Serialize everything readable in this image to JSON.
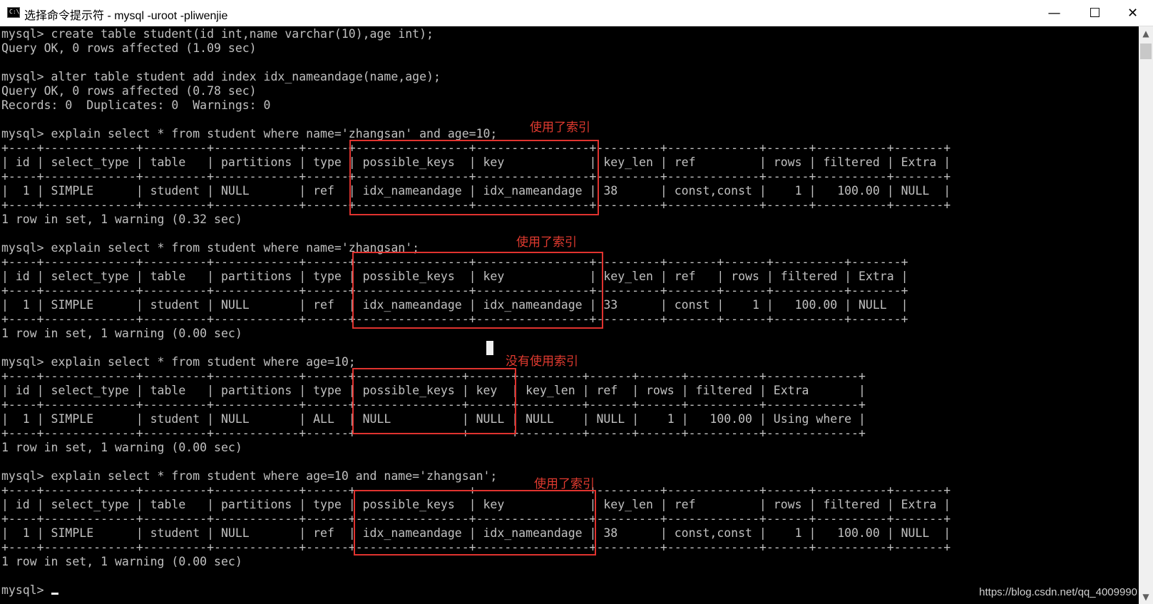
{
  "window": {
    "title": "选择命令提示符 - mysql  -uroot -pliwenjie",
    "icon_text": "C:\\",
    "minimize": "—",
    "maximize": "☐",
    "close": "✕"
  },
  "lines": [
    "mysql> create table student(id int,name varchar(10),age int);",
    "Query OK, 0 rows affected (1.09 sec)",
    "",
    "mysql> alter table student add index idx_nameandage(name,age);",
    "Query OK, 0 rows affected (0.78 sec)",
    "Records: 0  Duplicates: 0  Warnings: 0",
    "",
    "mysql> explain select * from student where name='zhangsan' and age=10;",
    "+----+-------------+---------+------------+------+----------------+----------------+---------+-------------+------+----------+-------+",
    "| id | select_type | table   | partitions | type | possible_keys  | key            | key_len | ref         | rows | filtered | Extra |",
    "+----+-------------+---------+------------+------+----------------+----------------+---------+-------------+------+----------+-------+",
    "|  1 | SIMPLE      | student | NULL       | ref  | idx_nameandage | idx_nameandage | 38      | const,const |    1 |   100.00 | NULL  |",
    "+----+-------------+---------+------------+------+----------------+----------------+---------+-------------+------+----------+-------+",
    "1 row in set, 1 warning (0.32 sec)",
    "",
    "mysql> explain select * from student where name='zhangsan';",
    "+----+-------------+---------+------------+------+----------------+----------------+---------+-------+------+----------+-------+",
    "| id | select_type | table   | partitions | type | possible_keys  | key            | key_len | ref   | rows | filtered | Extra |",
    "+----+-------------+---------+------------+------+----------------+----------------+---------+-------+------+----------+-------+",
    "|  1 | SIMPLE      | student | NULL       | ref  | idx_nameandage | idx_nameandage | 33      | const |    1 |   100.00 | NULL  |",
    "+----+-------------+---------+------------+------+----------------+----------------+---------+-------+------+----------+-------+",
    "1 row in set, 1 warning (0.00 sec)",
    "",
    "mysql> explain select * from student where age=10;",
    "+----+-------------+---------+------------+------+---------------+------+---------+------+------+----------+-------------+",
    "| id | select_type | table   | partitions | type | possible_keys | key  | key_len | ref  | rows | filtered | Extra       |",
    "+----+-------------+---------+------------+------+---------------+------+---------+------+------+----------+-------------+",
    "|  1 | SIMPLE      | student | NULL       | ALL  | NULL          | NULL | NULL    | NULL |    1 |   100.00 | Using where |",
    "+----+-------------+---------+------------+------+---------------+------+---------+------+------+----------+-------------+",
    "1 row in set, 1 warning (0.00 sec)",
    "",
    "mysql> explain select * from student where age=10 and name='zhangsan';",
    "+----+-------------+---------+------------+------+----------------+----------------+---------+-------------+------+----------+-------+",
    "| id | select_type | table   | partitions | type | possible_keys  | key            | key_len | ref         | rows | filtered | Extra |",
    "+----+-------------+---------+------------+------+----------------+----------------+---------+-------------+------+----------+-------+",
    "|  1 | SIMPLE      | student | NULL       | ref  | idx_nameandage | idx_nameandage | 38      | const,const |    1 |   100.00 | NULL  |",
    "+----+-------------+---------+------------+------+----------------+----------------+---------+-------------+------+----------+-------+",
    "1 row in set, 1 warning (0.00 sec)",
    "",
    "mysql> "
  ],
  "annotations": {
    "a1": "使用了索引",
    "a2": "使用了索引",
    "a3": "没有使用索引",
    "a4": "使用了索引"
  },
  "watermark": "https://blog.csdn.net/qq_4009990",
  "colors": {
    "highlight": "#e0332f",
    "console_text": "#c0c0c0",
    "background": "#000000"
  }
}
